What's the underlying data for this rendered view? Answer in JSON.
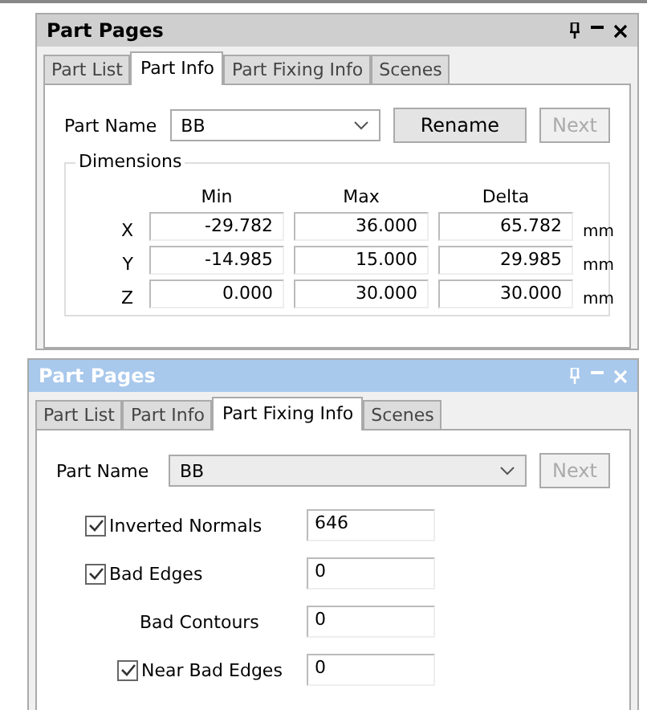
{
  "panels": [
    {
      "title": "Part Pages",
      "active": false,
      "tabs": [
        {
          "label": "Part List",
          "selected": false
        },
        {
          "label": "Part Info",
          "selected": true
        },
        {
          "label": "Part Fixing Info",
          "selected": false
        },
        {
          "label": "Scenes",
          "selected": false
        }
      ],
      "part_name": {
        "label": "Part Name",
        "value": "BB"
      },
      "buttons": [
        {
          "label": "Rename",
          "disabled": false
        },
        {
          "label": "Next",
          "disabled": true
        }
      ],
      "dimensions": {
        "title": "Dimensions",
        "columns": [
          "Min",
          "Max",
          "Delta"
        ],
        "rows": [
          {
            "axis": "X",
            "values": [
              "-29.782",
              "36.000",
              "65.782"
            ],
            "unit": "mm"
          },
          {
            "axis": "Y",
            "values": [
              "-14.985",
              "15.000",
              "29.985"
            ],
            "unit": "mm"
          },
          {
            "axis": "Z",
            "values": [
              "0.000",
              "30.000",
              "30.000"
            ],
            "unit": "mm"
          }
        ]
      }
    },
    {
      "title": "Part Pages",
      "active": true,
      "tabs": [
        {
          "label": "Part List",
          "selected": false
        },
        {
          "label": "Part Info",
          "selected": false
        },
        {
          "label": "Part Fixing Info",
          "selected": true
        },
        {
          "label": "Scenes",
          "selected": false
        }
      ],
      "part_name": {
        "label": "Part Name",
        "value": "BB"
      },
      "buttons": [
        {
          "label": "Next",
          "disabled": true
        }
      ],
      "checks": [
        {
          "kind": "checkbox",
          "label": "Inverted Normals",
          "checked": true,
          "value": "646"
        },
        {
          "kind": "checkbox",
          "label": "Bad Edges",
          "checked": true,
          "value": "0",
          "children": [
            {
              "kind": "plain",
              "label": "Bad Contours",
              "value": "0"
            },
            {
              "kind": "checkbox",
              "label": "Near Bad Edges",
              "checked": true,
              "value": "0"
            }
          ]
        }
      ]
    }
  ]
}
